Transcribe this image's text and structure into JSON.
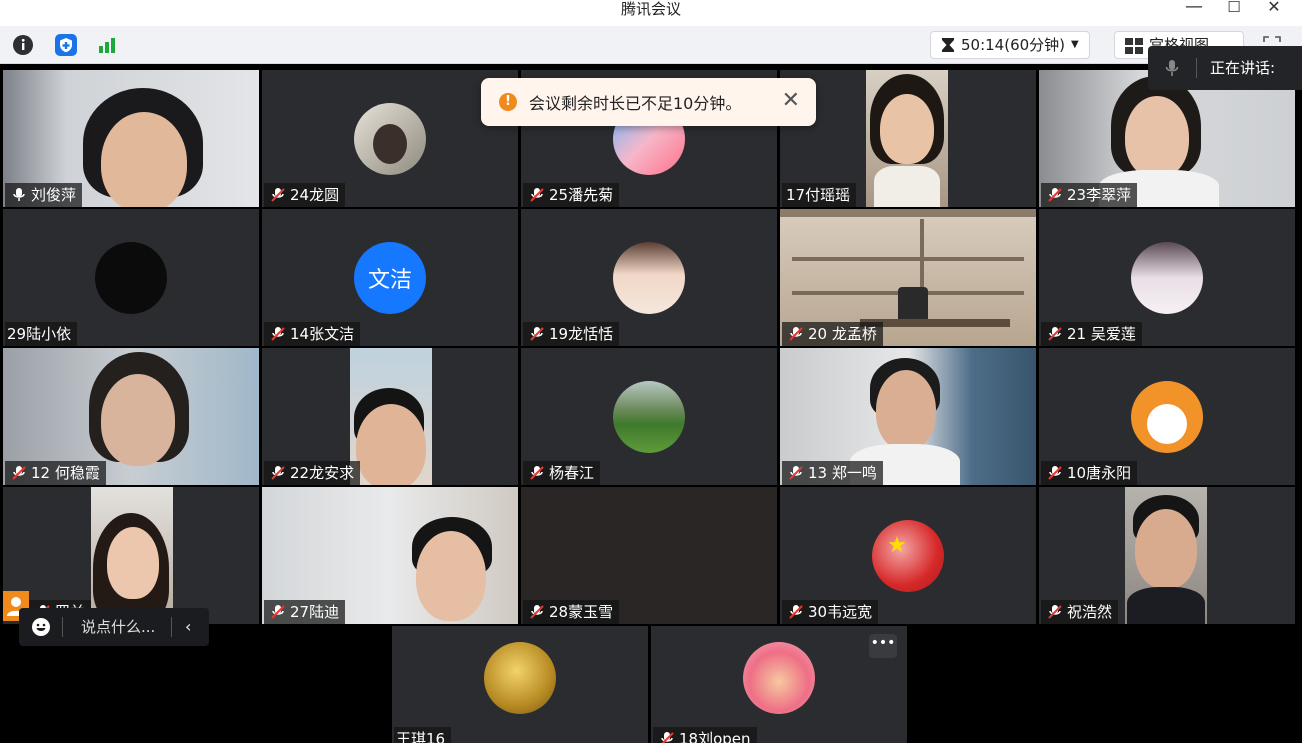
{
  "window": {
    "title": "腾讯会议",
    "minimize": "—",
    "maximize": "☐",
    "close": "✕"
  },
  "toolbar": {
    "timer": "50:14(60分钟)",
    "view_label": "宫格视图",
    "colors": {
      "info": "#2d2f33",
      "shield": "#1a73e8",
      "signal": "#1fa83a"
    }
  },
  "notification": {
    "message": "会议剩余时长已不足10分钟。",
    "close": "✕"
  },
  "speaking": {
    "label": "正在讲话:"
  },
  "chat": {
    "placeholder": "说点什么..."
  },
  "participants": [
    {
      "name": "刘俊萍",
      "mic": "on"
    },
    {
      "name": "24龙圆",
      "mic": "muted"
    },
    {
      "name": "25潘先菊",
      "mic": "muted"
    },
    {
      "name": "17付瑶瑶",
      "mic": "none"
    },
    {
      "name": "23李翠萍",
      "mic": "muted"
    },
    {
      "name": "29陆小依",
      "mic": "none"
    },
    {
      "name": "14张文洁",
      "mic": "muted",
      "avatar_text": "文洁"
    },
    {
      "name": "19龙恬恬",
      "mic": "muted"
    },
    {
      "name": "20 龙孟桥",
      "mic": "muted"
    },
    {
      "name": "21 吴爱莲",
      "mic": "muted"
    },
    {
      "name": "12 何稳霞",
      "mic": "muted"
    },
    {
      "name": "22龙安求",
      "mic": "muted"
    },
    {
      "name": "杨春江",
      "mic": "muted"
    },
    {
      "name": "13 郑一鸣",
      "mic": "muted"
    },
    {
      "name": "10唐永阳",
      "mic": "muted"
    },
    {
      "name": "罗兰",
      "mic": "muted"
    },
    {
      "name": "27陆迪",
      "mic": "muted"
    },
    {
      "name": "28蒙玉雪",
      "mic": "muted"
    },
    {
      "name": "30韦远宽",
      "mic": "muted"
    },
    {
      "name": "祝浩然",
      "mic": "muted"
    },
    {
      "name": "王琪16",
      "mic": "none"
    },
    {
      "name": "18刘open",
      "mic": "muted"
    }
  ]
}
